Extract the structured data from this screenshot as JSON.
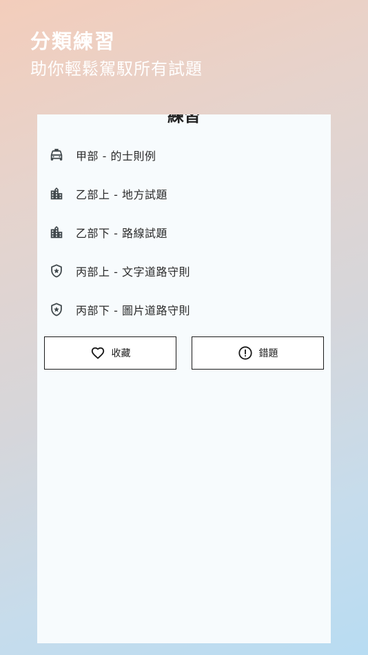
{
  "promo": {
    "title": "分類練習",
    "subtitle": "助你輕鬆駕馭所有試題"
  },
  "screen": {
    "title": "練習",
    "menu_items": [
      {
        "label": "甲部 - 的士則例",
        "icon": "taxi-icon"
      },
      {
        "label": "乙部上 - 地方試題",
        "icon": "city-icon"
      },
      {
        "label": "乙部下 - 路線試題",
        "icon": "city-icon"
      },
      {
        "label": "丙部上 - 文字道路守則",
        "icon": "shield-star-icon"
      },
      {
        "label": "丙部下 - 圖片道路守則",
        "icon": "shield-star-icon"
      }
    ],
    "actions": {
      "favorites_label": "收藏",
      "favorites_icon": "heart-icon",
      "mistakes_label": "錯題",
      "mistakes_icon": "exclamation-circle-icon"
    }
  }
}
